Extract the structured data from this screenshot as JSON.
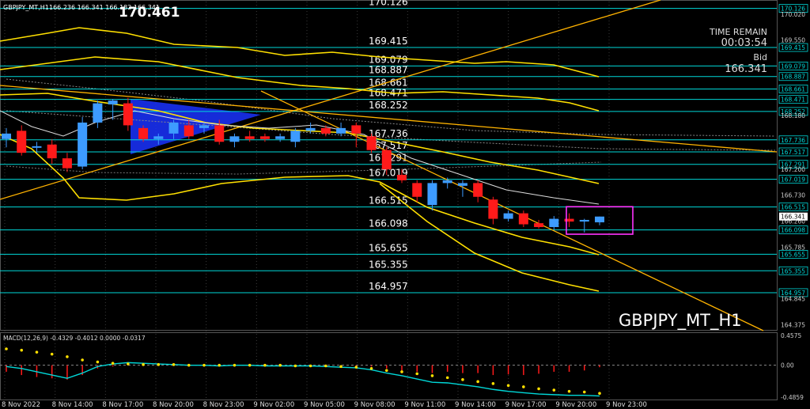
{
  "header": {
    "symbol_info": "GBPJPY_MT,H1",
    "ohlc": "166.236 166.341 166.182 166.341",
    "big_price": "170.461"
  },
  "info": {
    "time_remain_label": "TIME REMAIN",
    "time_remain_value": "00:03:54",
    "bid_label": "Bid",
    "bid_value": "166.341"
  },
  "watermark": "GBPJPY_MT_H1",
  "colors": {
    "background": "#000000",
    "bull": "#3d9bff",
    "bear": "#ff1a1a",
    "yellow": "#ffe000",
    "orange": "#ffb300",
    "cyan": "#00d8d8",
    "grid": "#3a3a3a",
    "box": "#ff33ff",
    "fill": "#1a33ff"
  },
  "chart_data": [
    {
      "type": "candlestick",
      "ylim": [
        164.28,
        170.25
      ],
      "y_ticks": [
        "170.020",
        "169.550",
        "168.180",
        "167.200",
        "166.730",
        "166.260",
        "165.785",
        "164.845",
        "164.375"
      ],
      "x_ticks": [
        "8 Nov 2022",
        "8 Nov 14:00",
        "8 Nov 17:00",
        "8 Nov 20:00",
        "8 Nov 23:00",
        "9 Nov 02:00",
        "9 Nov 05:00",
        "9 Nov 08:00",
        "9 Nov 11:00",
        "9 Nov 14:00",
        "9 Nov 17:00",
        "9 Nov 20:00",
        "9 Nov 23:00"
      ],
      "levels": [
        {
          "label": "170.126",
          "value": 170.126
        },
        {
          "label": "169.415",
          "value": 169.415
        },
        {
          "label": "169.079",
          "value": 169.079
        },
        {
          "label": "168.887",
          "value": 168.887
        },
        {
          "label": "168.661",
          "value": 168.661
        },
        {
          "label": "168.471",
          "value": 168.471
        },
        {
          "label": "168.252",
          "value": 168.252
        },
        {
          "label": "167.736",
          "value": 167.736
        },
        {
          "label": "167.517",
          "value": 167.517
        },
        {
          "label": "167.291",
          "value": 167.291
        },
        {
          "label": "167.019",
          "value": 167.019
        },
        {
          "label": "166.515",
          "value": 166.515
        },
        {
          "label": "166.098",
          "value": 166.098
        },
        {
          "label": "165.655",
          "value": 165.655
        },
        {
          "label": "165.355",
          "value": 165.355
        },
        {
          "label": "164.957",
          "value": 164.957
        }
      ],
      "current_price": {
        "label": "166.341",
        "value": 166.341
      },
      "candles": [
        {
          "o": 167.75,
          "h": 167.95,
          "l": 167.6,
          "c": 167.85
        },
        {
          "o": 167.9,
          "h": 168.0,
          "l": 167.45,
          "c": 167.5
        },
        {
          "o": 167.6,
          "h": 167.7,
          "l": 167.5,
          "c": 167.62
        },
        {
          "o": 167.65,
          "h": 167.75,
          "l": 167.3,
          "c": 167.4
        },
        {
          "o": 167.4,
          "h": 167.5,
          "l": 167.15,
          "c": 167.22
        },
        {
          "o": 167.25,
          "h": 168.15,
          "l": 167.2,
          "c": 168.05
        },
        {
          "o": 168.05,
          "h": 168.45,
          "l": 167.95,
          "c": 168.4
        },
        {
          "o": 168.38,
          "h": 168.48,
          "l": 168.1,
          "c": 168.45
        },
        {
          "o": 168.4,
          "h": 168.5,
          "l": 167.9,
          "c": 168.0
        },
        {
          "o": 167.95,
          "h": 168.0,
          "l": 167.7,
          "c": 167.75
        },
        {
          "o": 167.75,
          "h": 167.85,
          "l": 167.65,
          "c": 167.8
        },
        {
          "o": 167.85,
          "h": 168.1,
          "l": 167.75,
          "c": 168.05
        },
        {
          "o": 168.0,
          "h": 168.1,
          "l": 167.75,
          "c": 167.8
        },
        {
          "o": 167.95,
          "h": 168.05,
          "l": 167.85,
          "c": 168.0
        },
        {
          "o": 168.0,
          "h": 168.1,
          "l": 167.65,
          "c": 167.7
        },
        {
          "o": 167.7,
          "h": 167.85,
          "l": 167.6,
          "c": 167.8
        },
        {
          "o": 167.8,
          "h": 167.9,
          "l": 167.7,
          "c": 167.75
        },
        {
          "o": 167.8,
          "h": 167.85,
          "l": 167.7,
          "c": 167.75
        },
        {
          "o": 167.75,
          "h": 167.85,
          "l": 167.7,
          "c": 167.8
        },
        {
          "o": 167.7,
          "h": 167.95,
          "l": 167.6,
          "c": 167.9
        },
        {
          "o": 167.9,
          "h": 168.05,
          "l": 167.85,
          "c": 167.95
        },
        {
          "o": 167.95,
          "h": 168.0,
          "l": 167.8,
          "c": 167.85
        },
        {
          "o": 167.85,
          "h": 168.05,
          "l": 167.8,
          "c": 167.95
        },
        {
          "o": 168.0,
          "h": 168.05,
          "l": 167.6,
          "c": 167.85
        },
        {
          "o": 167.8,
          "h": 167.85,
          "l": 167.5,
          "c": 167.55
        },
        {
          "o": 167.55,
          "h": 167.6,
          "l": 167.1,
          "c": 167.2
        },
        {
          "o": 167.1,
          "h": 167.2,
          "l": 166.95,
          "c": 167.0
        },
        {
          "o": 166.95,
          "h": 167.0,
          "l": 166.6,
          "c": 166.7
        },
        {
          "o": 166.55,
          "h": 167.0,
          "l": 166.45,
          "c": 166.95
        },
        {
          "o": 166.95,
          "h": 167.05,
          "l": 166.85,
          "c": 167.0
        },
        {
          "o": 166.9,
          "h": 167.0,
          "l": 166.7,
          "c": 166.95
        },
        {
          "o": 166.95,
          "h": 167.0,
          "l": 166.6,
          "c": 166.7
        },
        {
          "o": 166.65,
          "h": 166.7,
          "l": 166.2,
          "c": 166.3
        },
        {
          "o": 166.3,
          "h": 166.45,
          "l": 166.25,
          "c": 166.4
        },
        {
          "o": 166.4,
          "h": 166.45,
          "l": 166.15,
          "c": 166.2
        },
        {
          "o": 166.22,
          "h": 166.28,
          "l": 166.12,
          "c": 166.15
        },
        {
          "o": 166.15,
          "h": 166.35,
          "l": 166.1,
          "c": 166.3
        },
        {
          "o": 166.3,
          "h": 166.4,
          "l": 166.15,
          "c": 166.25
        },
        {
          "o": 166.25,
          "h": 166.3,
          "l": 166.05,
          "c": 166.28
        },
        {
          "o": 166.236,
          "h": 166.341,
          "l": 166.182,
          "c": 166.341
        }
      ]
    },
    {
      "type": "macd",
      "title": "MACD(12,26,9) -0.4329 -0.4012 0.0000 -0.0317",
      "ylim": [
        -0.5,
        0.48
      ],
      "y_ticks": [
        "0.4575",
        "0.00",
        "-0.4859"
      ],
      "histogram": [
        -0.1,
        -0.15,
        -0.18,
        -0.2,
        -0.22,
        -0.15,
        -0.05,
        -0.02,
        0.02,
        0.03,
        0.02,
        0.01,
        0.0,
        0.0,
        -0.01,
        0.0,
        0.0,
        -0.01,
        -0.01,
        0.0,
        0.0,
        0.0,
        0.0,
        -0.01,
        -0.02,
        -0.05,
        -0.08,
        -0.1,
        -0.12,
        -0.1,
        -0.12,
        -0.12,
        -0.15,
        -0.14,
        -0.15,
        -0.13,
        -0.1,
        -0.1,
        -0.08,
        -0.03
      ],
      "signal": [
        0.25,
        0.23,
        0.2,
        0.17,
        0.13,
        0.08,
        0.05,
        0.03,
        0.02,
        0.01,
        0.01,
        0.01,
        0.0,
        0.0,
        0.0,
        0.0,
        0.0,
        0.0,
        0.0,
        -0.01,
        -0.01,
        -0.01,
        -0.02,
        -0.03,
        -0.05,
        -0.08,
        -0.1,
        -0.13,
        -0.16,
        -0.19,
        -0.22,
        -0.25,
        -0.28,
        -0.31,
        -0.33,
        -0.36,
        -0.38,
        -0.4,
        -0.41,
        -0.43
      ],
      "macd_line": [
        -0.02,
        -0.05,
        -0.1,
        -0.15,
        -0.2,
        -0.12,
        -0.02,
        0.02,
        0.04,
        0.03,
        0.02,
        0.01,
        0.0,
        0.0,
        -0.01,
        0.0,
        0.0,
        -0.01,
        -0.01,
        -0.01,
        -0.01,
        -0.02,
        -0.03,
        -0.04,
        -0.07,
        -0.12,
        -0.16,
        -0.21,
        -0.26,
        -0.27,
        -0.3,
        -0.33,
        -0.37,
        -0.4,
        -0.42,
        -0.44,
        -0.45,
        -0.46,
        -0.46,
        -0.47
      ]
    }
  ]
}
